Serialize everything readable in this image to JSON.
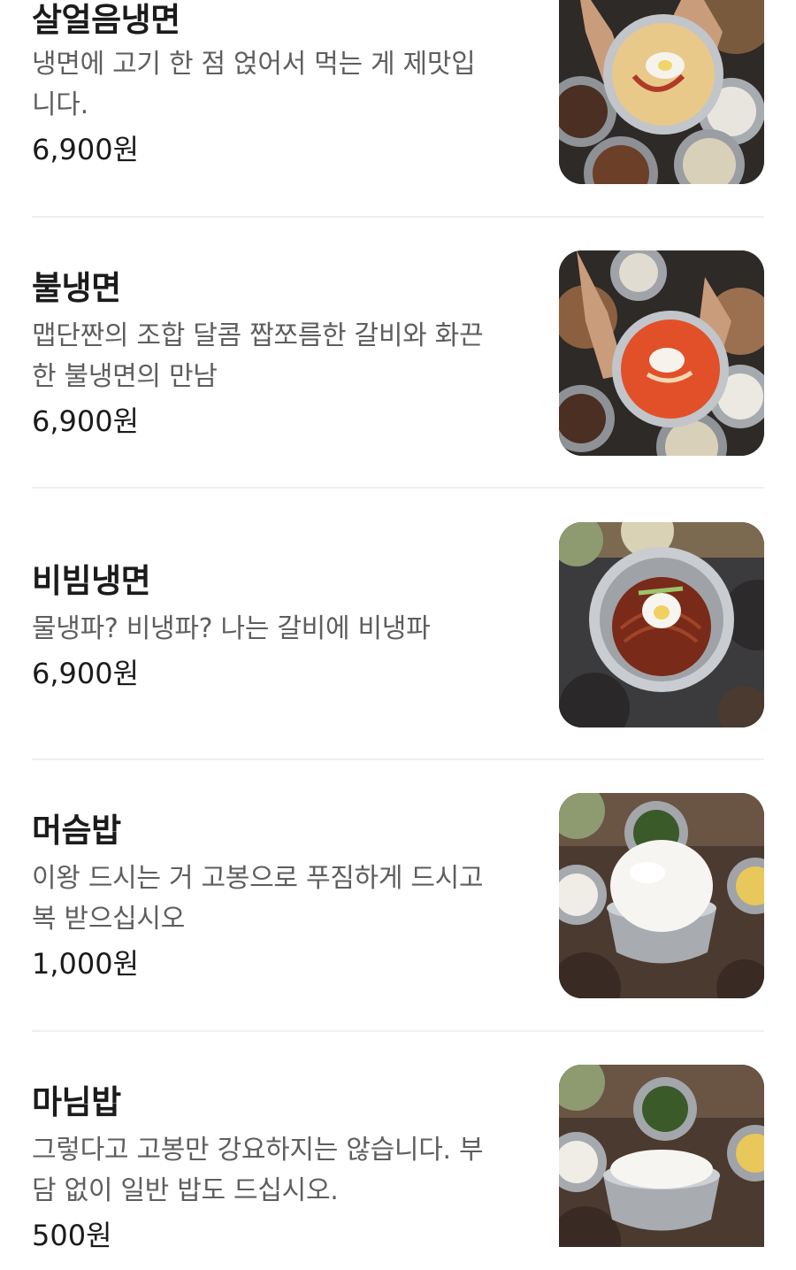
{
  "menu": {
    "items": [
      {
        "name": "살얼음냉면",
        "desc_line1": "냉면에 고기 한 점 얹어서 먹는 게 제맛입",
        "desc_line2": "니다.",
        "price": "6,900원",
        "photo_icon": "cold-noodle-photo",
        "photo_kind": "cold"
      },
      {
        "name": "불냉면",
        "desc_line1": "맵단짠의 조합 달콤 짭쪼름한 갈비와 화끈",
        "desc_line2": "한 불냉면의 만남",
        "price": "6,900원",
        "photo_icon": "spicy-noodle-photo",
        "photo_kind": "spicy"
      },
      {
        "name": "비빔냉면",
        "desc_line1": "물냉파? 비냉파? 나는 갈비에 비냉파",
        "desc_line2": "",
        "price": "6,900원",
        "photo_icon": "bibim-noodle-photo",
        "photo_kind": "bibim"
      },
      {
        "name": "머슴밥",
        "desc_line1": "이왕 드시는 거 고봉으로 푸짐하게 드시고",
        "desc_line2": "복 받으십시오",
        "price": "1,000원",
        "photo_icon": "large-rice-photo",
        "photo_kind": "rice-large"
      },
      {
        "name": "마님밥",
        "desc_line1": "그렇다고 고봉만 강요하지는 않습니다. 부",
        "desc_line2": "담 없이 일반 밥도 드십시오.",
        "price": "500원",
        "photo_icon": "rice-bowl-photo",
        "photo_kind": "rice-small"
      }
    ]
  },
  "colors": {
    "text_primary": "#1b1b1b",
    "text_secondary": "#5e5e5e",
    "divider": "#efefef",
    "broth": "#e9c98a",
    "spicy_broth": "#e2502a",
    "bibim_sauce": "#7a2a18",
    "steel": "#b9bcc0"
  }
}
